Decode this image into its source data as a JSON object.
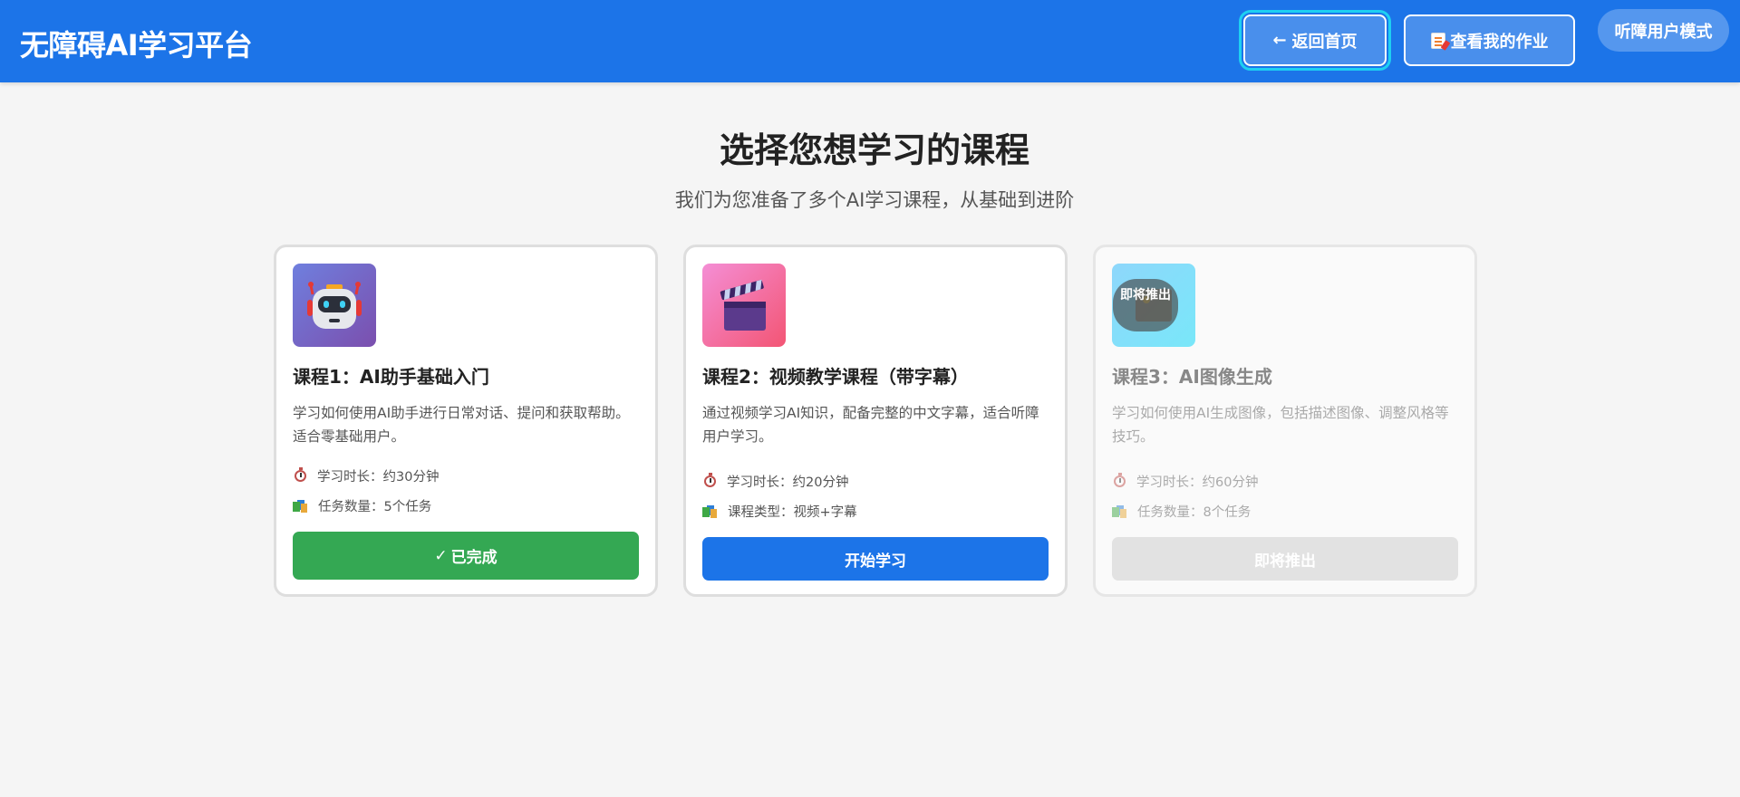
{
  "header": {
    "brand": "无障碍AI学习平台",
    "home_button": {
      "icon": "←",
      "label": "返回首页"
    },
    "homework_button": {
      "icon": "document-icon",
      "label": "查看我的作业"
    },
    "mode_button": "听障用户模式"
  },
  "main": {
    "title": "选择您想学习的课程",
    "subtitle": "我们为您准备了多个AI学习课程，从基础到进阶"
  },
  "courses": [
    {
      "icon": "robot-icon",
      "title": "课程1：AI助手基础入门",
      "description": "学习如何使用AI助手进行日常对话、提问和获取帮助。适合零基础用户。",
      "meta": [
        {
          "icon": "timer-icon",
          "text": "学习时长：约30分钟"
        },
        {
          "icon": "books-icon",
          "text": "任务数量：5个任务"
        }
      ],
      "button": {
        "icon": "✓",
        "label": "已完成",
        "status": "completed",
        "color": "#34a853"
      }
    },
    {
      "icon": "clapperboard-icon",
      "title": "课程2：视频教学课程（带字幕）",
      "description": "通过视频学习AI知识，配备完整的中文字幕，适合听障用户学习。",
      "meta": [
        {
          "icon": "timer-icon",
          "text": "学习时长：约20分钟"
        },
        {
          "icon": "books-icon",
          "text": "课程类型：视频+字幕"
        }
      ],
      "button": {
        "label": "开始学习",
        "status": "available",
        "color": "#1c74e8"
      }
    },
    {
      "icon": "image-icon",
      "badge": "即将推出",
      "title": "课程3：AI图像生成",
      "description": "学习如何使用AI生成图像，包括描述图像、调整风格等技巧。",
      "meta": [
        {
          "icon": "timer-icon",
          "text": "学习时长：约60分钟"
        },
        {
          "icon": "books-icon",
          "text": "任务数量：8个任务"
        }
      ],
      "button": {
        "label": "即将推出",
        "status": "disabled",
        "color": "#e2e2e2"
      }
    }
  ],
  "colors": {
    "header": "#1c74e8",
    "focus_ring": "#1ed0f2",
    "background": "#f5f5f5"
  }
}
